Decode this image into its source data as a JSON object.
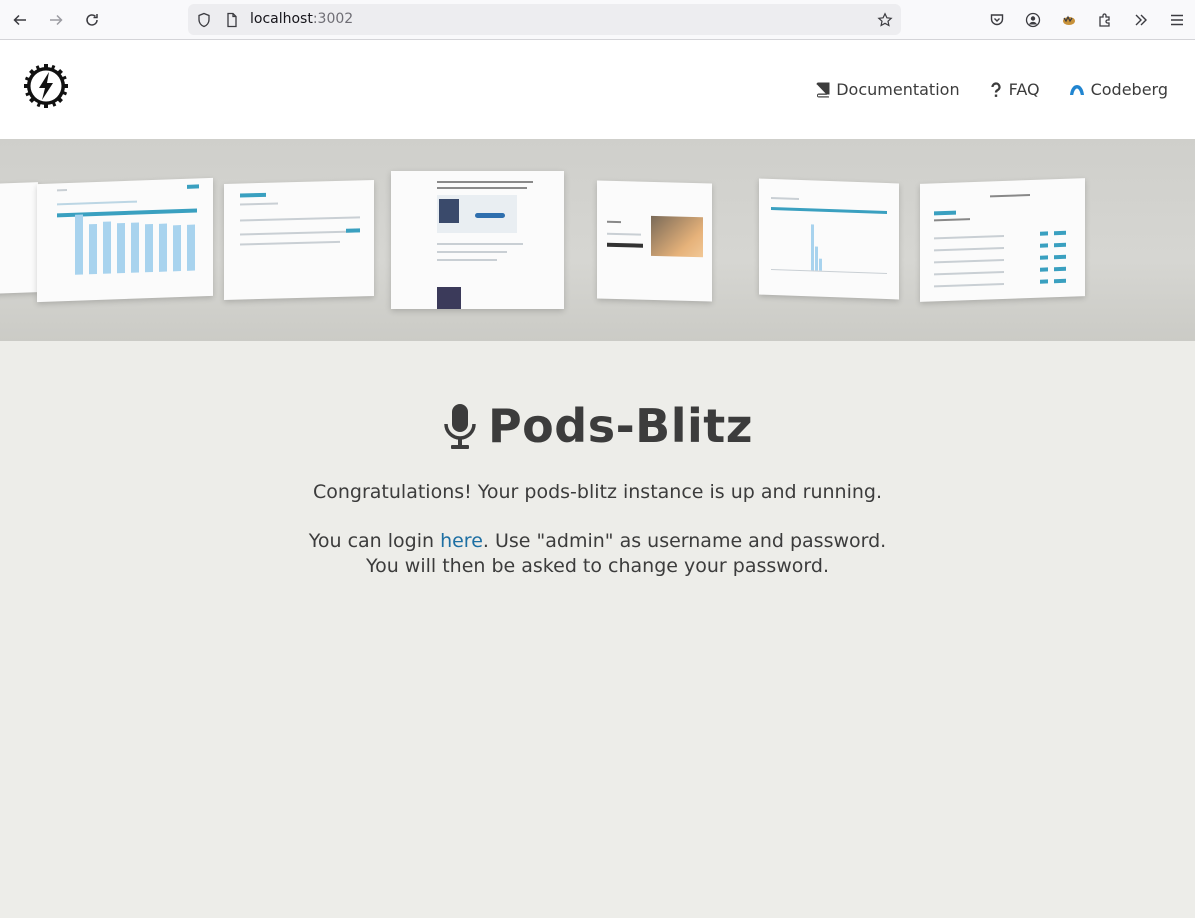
{
  "browser": {
    "url_host": "localhost",
    "url_port": ":3002"
  },
  "nav": {
    "documentation": "Documentation",
    "faq": "FAQ",
    "codeberg": "Codeberg"
  },
  "main": {
    "title": "Pods-Blitz",
    "congrats": "Congratulations! Your pods-blitz instance is up and running.",
    "login_prefix": "You can login ",
    "login_link": "here",
    "login_suffix": ". Use \"admin\" as username and password.",
    "change_password": "You will then be asked to change your password."
  },
  "colors": {
    "link": "#1d6fa3",
    "accent": "#3aa0c0",
    "background": "#edede9"
  }
}
